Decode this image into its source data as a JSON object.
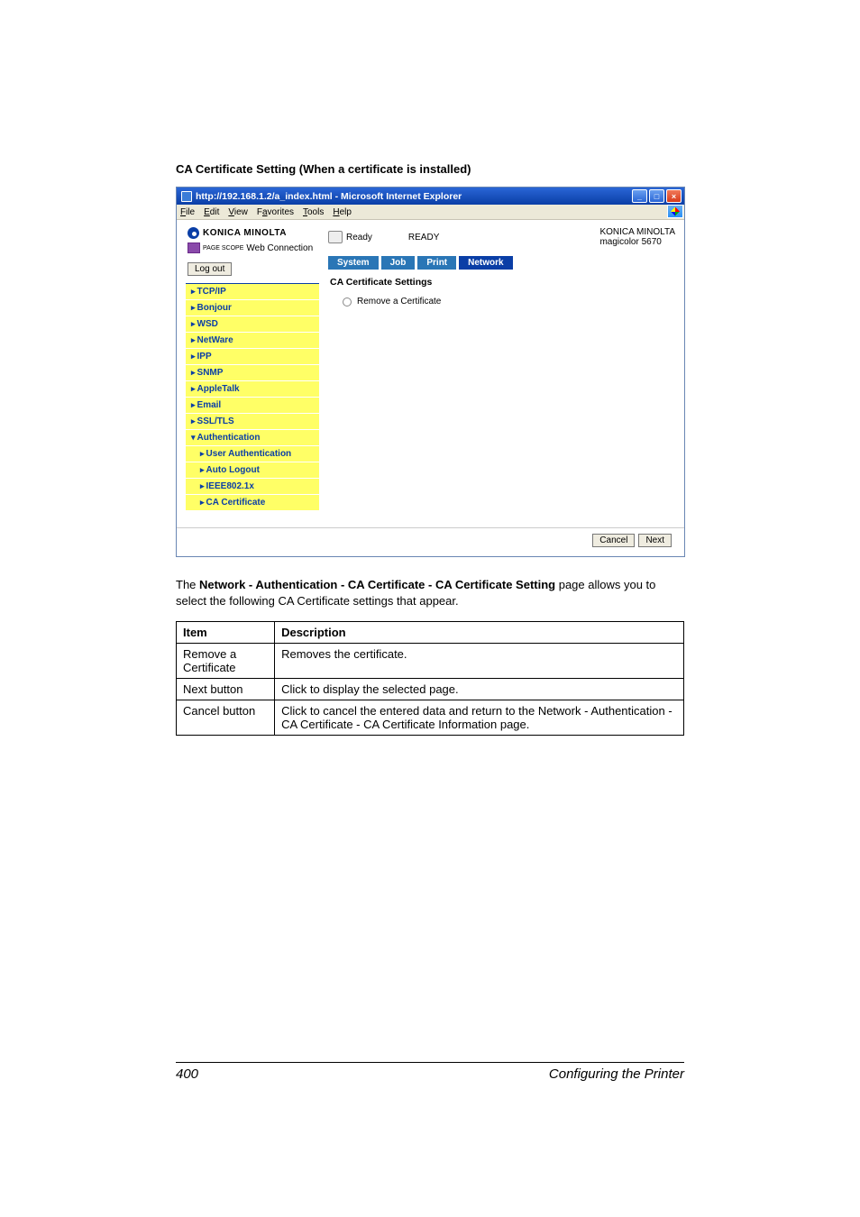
{
  "section_title": "CA Certificate Setting (When a certificate is installed)",
  "window": {
    "title": "http://192.168.1.2/a_index.html - Microsoft Internet Explorer",
    "menus": [
      "File",
      "Edit",
      "View",
      "Favorites",
      "Tools",
      "Help"
    ],
    "menu_underline_idx": [
      0,
      0,
      0,
      1,
      0,
      0
    ]
  },
  "brand": {
    "name": "KONICA MINOLTA",
    "sub_small": "PAGE SCOPE",
    "sub": "Web Connection"
  },
  "status": {
    "ready_icon_label": "Ready",
    "ready_caps": "READY",
    "vendor": "KONICA MINOLTA",
    "model": "magicolor 5670"
  },
  "logout_label": "Log out",
  "tabs": [
    {
      "label": "System",
      "active": false
    },
    {
      "label": "Job",
      "active": false
    },
    {
      "label": "Print",
      "active": false
    },
    {
      "label": "Network",
      "active": true
    }
  ],
  "sidenav": [
    {
      "label": "TCP/IP",
      "type": "item"
    },
    {
      "label": "Bonjour",
      "type": "item"
    },
    {
      "label": "WSD",
      "type": "item"
    },
    {
      "label": "NetWare",
      "type": "item"
    },
    {
      "label": "IPP",
      "type": "item"
    },
    {
      "label": "SNMP",
      "type": "item"
    },
    {
      "label": "AppleTalk",
      "type": "item"
    },
    {
      "label": "Email",
      "type": "item"
    },
    {
      "label": "SSL/TLS",
      "type": "item"
    },
    {
      "label": "Authentication",
      "type": "item_open"
    },
    {
      "label": "User Authentication",
      "type": "sub"
    },
    {
      "label": "Auto Logout",
      "type": "sub"
    },
    {
      "label": "IEEE802.1x",
      "type": "sub"
    },
    {
      "label": "CA Certificate",
      "type": "sub"
    }
  ],
  "panel": {
    "title": "CA Certificate Settings",
    "option": "Remove a Certificate"
  },
  "footer_buttons": {
    "cancel": "Cancel",
    "next": "Next"
  },
  "body_text": {
    "prefix": "The ",
    "bold": "Network - Authentication - CA Certificate - CA Certificate Setting",
    "suffix": " page allows you to select the following CA Certificate settings that appear."
  },
  "table": {
    "headers": [
      "Item",
      "Description"
    ],
    "rows": [
      {
        "item": "Remove a Certificate",
        "desc_plain": "Removes the certificate."
      },
      {
        "item": "Next button",
        "desc_plain": "Click to display the selected page."
      },
      {
        "item": "Cancel button",
        "desc_pre": "Click to cancel the entered data and return to the ",
        "desc_bold": "Network - Authentication - CA Certificate - CA Certificate Information",
        "desc_post": " page."
      }
    ]
  },
  "page_footer": {
    "number": "400",
    "title": "Configuring the Printer"
  }
}
